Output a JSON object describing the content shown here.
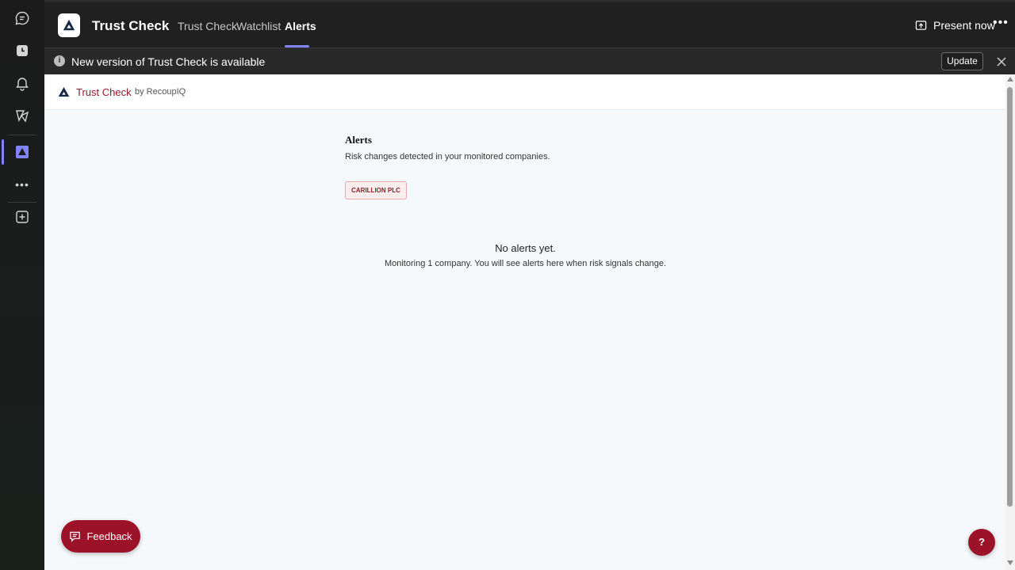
{
  "header": {
    "app_title": "Trust Check",
    "tabs": [
      {
        "label": "Trust Check",
        "active": false
      },
      {
        "label": "Watchlist",
        "active": false
      },
      {
        "label": "Alerts",
        "active": true
      }
    ],
    "present_label": "Present now",
    "more_label": "•••"
  },
  "rail": {
    "items": [
      {
        "icon": "chat-icon"
      },
      {
        "icon": "calendar-icon"
      },
      {
        "icon": "bell-icon"
      },
      {
        "icon": "shapes-icon"
      },
      {
        "icon": "trust-check-app-icon",
        "active": true
      },
      {
        "icon": "more-apps-icon"
      },
      {
        "icon": "add-app-icon"
      }
    ],
    "more_label": "•••"
  },
  "notice": {
    "info_glyph": "i",
    "text": "New version of Trust Check is available",
    "update_label": "Update"
  },
  "brandbar": {
    "name": "Trust Check",
    "by": "by RecoupIQ"
  },
  "alerts": {
    "title": "Alerts",
    "subtitle": "Risk changes detected in your monitored companies.",
    "company_chip": "CARILLION PLC",
    "empty_title": "No alerts yet.",
    "empty_subtitle": "Monitoring 1 company. You will see alerts here when risk signals change."
  },
  "feedback_label": "Feedback",
  "help_label": "?",
  "colors": {
    "accent": "#7f85f5",
    "brand": "#9c1228",
    "brand_text": "#8b1d2c",
    "chip_bg": "#fdeeee"
  }
}
